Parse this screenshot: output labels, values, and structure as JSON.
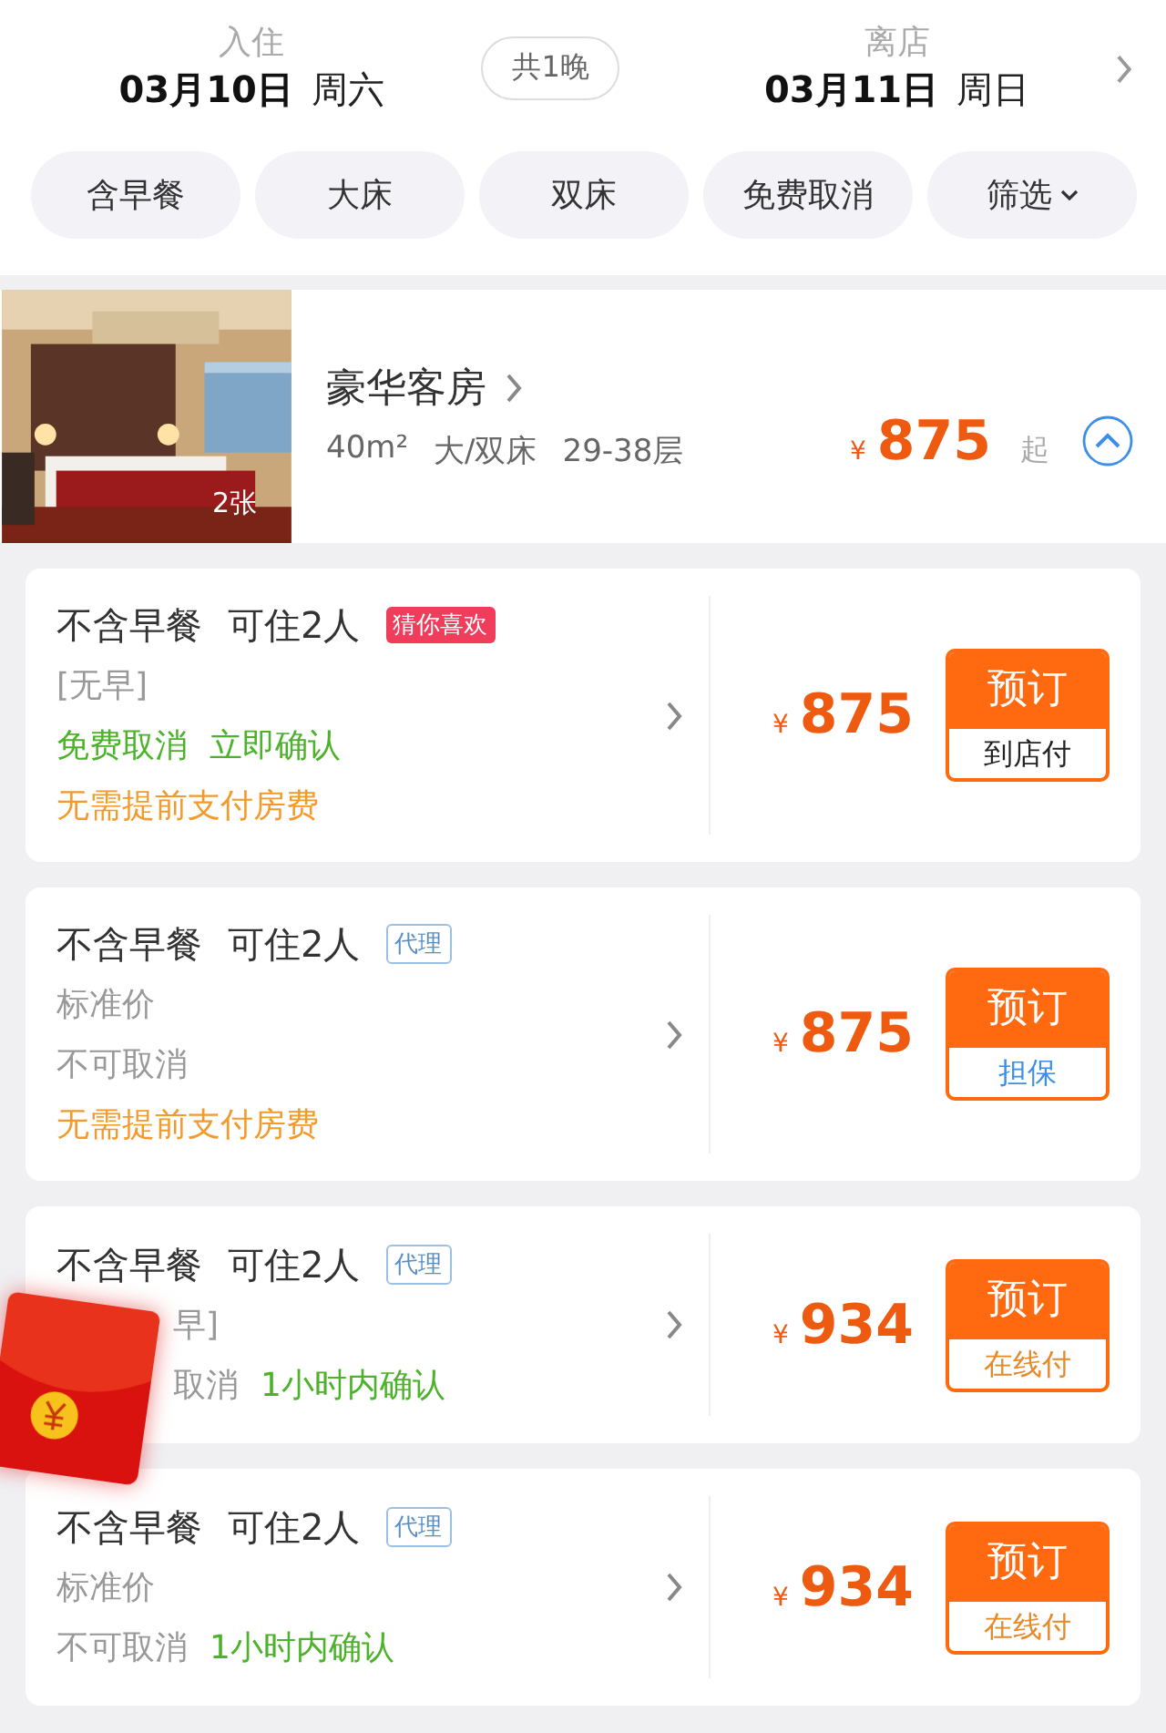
{
  "dates": {
    "checkin": {
      "label": "入住",
      "date": "03月10日",
      "weekday": "周六"
    },
    "nights": "共1晚",
    "checkout": {
      "label": "离店",
      "date": "03月11日",
      "weekday": "周日"
    }
  },
  "filters": [
    {
      "label": "含早餐",
      "dropdown": false
    },
    {
      "label": "大床",
      "dropdown": false
    },
    {
      "label": "双床",
      "dropdown": false
    },
    {
      "label": "免费取消",
      "dropdown": false
    },
    {
      "label": "筛选",
      "dropdown": true
    }
  ],
  "room": {
    "photo": {
      "kind": "picture",
      "count": "2张"
    },
    "name": "豪华客房",
    "area": "40m²",
    "bed": "大/双床",
    "floors": "29-38层",
    "currency": "¥",
    "price": "875",
    "suffix": "起",
    "expanded": true
  },
  "offers": [
    {
      "title": "不含早餐",
      "guests": "可住2人",
      "tag": {
        "text": "猜你喜欢",
        "kind": "hot"
      },
      "lines": [
        [
          {
            "text": "[无早]",
            "color": "#999999"
          }
        ],
        [
          {
            "text": "免费取消",
            "color": "#4cb22a"
          },
          {
            "text": "立即确认",
            "color": "#4cb22a"
          }
        ],
        [
          {
            "text": "无需提前支付房费",
            "color": "#f29a2c"
          }
        ]
      ],
      "currency": "¥",
      "price": "875",
      "button": "预订",
      "payment": {
        "text": "到店付",
        "color": "#222222"
      }
    },
    {
      "title": "不含早餐",
      "guests": "可住2人",
      "tag": {
        "text": "代理",
        "kind": "agent"
      },
      "lines": [
        [
          {
            "text": "标准价",
            "color": "#999999"
          }
        ],
        [
          {
            "text": "不可取消",
            "color": "#999999"
          }
        ],
        [
          {
            "text": "无需提前支付房费",
            "color": "#f29a2c"
          }
        ]
      ],
      "currency": "¥",
      "price": "875",
      "button": "预订",
      "payment": {
        "text": "担保",
        "color": "#3d8ee8"
      }
    },
    {
      "title": "不含早餐",
      "guests": "可住2人",
      "tag": {
        "text": "代理",
        "kind": "agent"
      },
      "lines": [
        [
          {
            "text": "早]",
            "color": "#999999",
            "covered": true
          }
        ],
        [
          {
            "text": "取消",
            "color": "#999999",
            "covered": true
          },
          {
            "text": "1小时内确认",
            "color": "#4cb22a"
          }
        ]
      ],
      "currency": "¥",
      "price": "934",
      "button": "预订",
      "payment": {
        "text": "在线付",
        "color": "#e48a2a"
      }
    },
    {
      "title": "不含早餐",
      "guests": "可住2人",
      "tag": {
        "text": "代理",
        "kind": "agent"
      },
      "lines": [
        [
          {
            "text": "标准价",
            "color": "#999999"
          }
        ],
        [
          {
            "text": "不可取消",
            "color": "#999999"
          },
          {
            "text": "1小时内确认",
            "color": "#4cb22a"
          }
        ]
      ],
      "currency": "¥",
      "price": "934",
      "button": "预订",
      "payment": {
        "text": "在线付",
        "color": "#e48a2a"
      }
    }
  ]
}
